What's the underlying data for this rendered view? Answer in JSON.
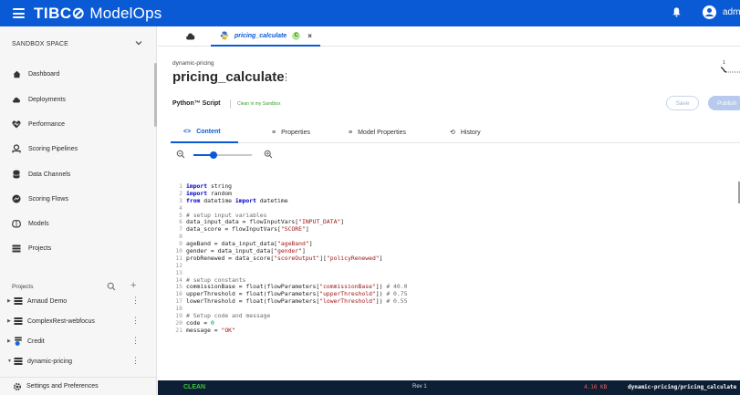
{
  "header": {
    "brand_prefix": "TIBC",
    "brand_suffix": "ModelOps",
    "user": "admin",
    "color": "#0a5ad6"
  },
  "sidebar": {
    "space": "SANDBOX SPACE",
    "items": [
      {
        "label": "Dashboard",
        "icon": "home-icon"
      },
      {
        "label": "Deployments",
        "icon": "cloud-icon"
      },
      {
        "label": "Performance",
        "icon": "heart-pulse-icon"
      },
      {
        "label": "Scoring Pipelines",
        "icon": "pipeline-icon"
      },
      {
        "label": "Data Channels",
        "icon": "database-icon"
      },
      {
        "label": "Scoring Flows",
        "icon": "flow-icon"
      },
      {
        "label": "Models",
        "icon": "brain-icon"
      },
      {
        "label": "Projects",
        "icon": "projects-icon"
      }
    ],
    "projects_heading": "Projects",
    "projects": [
      {
        "label": "Arnaud Demo"
      },
      {
        "label": "ComplexRest-webfocus"
      },
      {
        "label": "Credit"
      },
      {
        "label": "dynamic-pricing"
      }
    ],
    "settings": "Settings and Preferences"
  },
  "tabs": {
    "file_tab": "pricing_calculate",
    "file_badge": "C",
    "close": "×"
  },
  "page": {
    "breadcrumb": "dynamic-pricing",
    "title": "pricing_calculate",
    "script_type": "Python™ Script",
    "status": "Clean in my Sandbox",
    "save": "Save",
    "publish": "Publish",
    "graph_label": "1"
  },
  "subtabs": [
    {
      "label": "Content",
      "icon": "<>"
    },
    {
      "label": "Properties",
      "icon": "≡"
    },
    {
      "label": "Model Properties",
      "icon": "≡"
    },
    {
      "label": "History",
      "icon": "⟲"
    }
  ],
  "zoom": {
    "level": 0.35
  },
  "code": [
    "import string",
    "import random",
    "from datetime import datetime",
    "",
    "# setup input variables",
    "data_input_data = flowInputVars[\"INPUT_DATA\"]",
    "data_score = flowInputVars[\"SCORE\"]",
    "",
    "ageBand = data_input_data[\"ageBand\"]",
    "gender = data_input_data[\"gender\"]",
    "probRenewed = data_score[\"scoreOutput\"][\"policyRenewed\"]",
    "",
    "",
    "# setup constants",
    "commissionBase = float(flowParameters[\"commissionBase\"]) # 40.0",
    "upperThreshold = float(flowParameters[\"upperThreshold\"]) # 0.75",
    "lowerThreshold = float(flowParameters[\"lowerThreshold\"]) # 0.55",
    "",
    "# Setup code and message",
    "code = 0",
    "message = \"OK\""
  ],
  "status_bar": {
    "state": "CLEAN",
    "rev": "Rev 1",
    "size": "4.16 KB",
    "path": "dynamic-pricing/pricing_calculate"
  }
}
